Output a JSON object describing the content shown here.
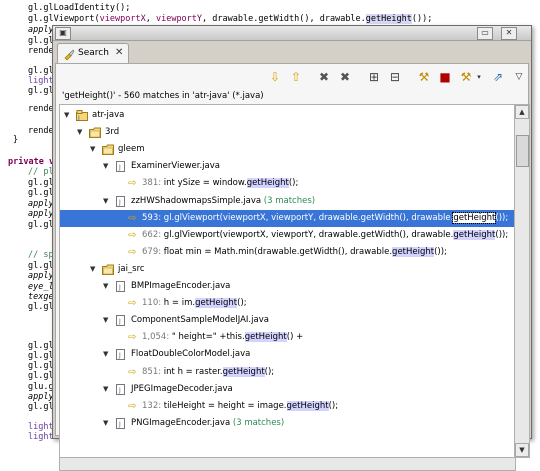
{
  "background_code": [
    "gl.glLoadIdentity();",
    "gl.glViewport(viewportX, viewportY, drawable.getWidth(), drawable.getHeight());",
    "applyR",
    "gl.gl",
    "render",
    "gl.gl",
    "light",
    "gl.gl",
    "render",
    "render",
    "}",
    "private vo",
    "// pl",
    "gl.gl",
    "gl.gl",
    "applyT",
    "applyR",
    "gl.gl",
    "// sp",
    "gl.gl",
    "applyT",
    "eye_li",
    "texgen",
    "gl.gl",
    "gl.gl",
    "gl.gl",
    "gl.gl",
    "gl.gl",
    "glu.gl",
    "applyR",
    "gl.gl",
    "light",
    "light"
  ],
  "window": {
    "tab_label": "Search",
    "summary": "'getHeight()' - 560 matches in 'atr-java' (*.java)",
    "colors": {
      "selection": "#3875d7",
      "highlight": "#d3d3ff",
      "count": "#2e8b57"
    }
  },
  "tree": [
    {
      "kind": "project",
      "label": "atr-java",
      "icon": "project-icon"
    },
    {
      "kind": "folder",
      "label": "3rd",
      "icon": "folder-icon"
    },
    {
      "kind": "folder",
      "label": "gleem",
      "icon": "folder-icon"
    },
    {
      "kind": "file",
      "label": "ExaminerViewer.java",
      "icon": "java-file-icon"
    },
    {
      "kind": "match",
      "num": "381:",
      "pre": "int ySize = window.",
      "hit": "getHeight",
      "post": "();"
    },
    {
      "kind": "file",
      "label": "zzHWShadowmapsSimple.java",
      "count": "(3 matches)",
      "icon": "java-file-icon"
    },
    {
      "kind": "match",
      "num": "593:",
      "pre": "gl.glViewport(viewportX, viewportY, drawable.getWidth(), drawable.",
      "hit": "getHeight",
      "post": "());",
      "selected": true
    },
    {
      "kind": "match",
      "num": "662:",
      "pre": "gl.glViewport(viewportX, viewportY, drawable.getWidth(), drawable.",
      "hit": "getHeight",
      "post": "());"
    },
    {
      "kind": "match",
      "num": "679:",
      "pre": "float min = Math.min(drawable.getWidth(), drawable.",
      "hit": "getHeight",
      "post": "());"
    },
    {
      "kind": "folder",
      "label": "jai_src",
      "icon": "folder-icon"
    },
    {
      "kind": "file",
      "label": "BMPImageEncoder.java",
      "icon": "java-file-icon"
    },
    {
      "kind": "match",
      "num": "110:",
      "pre": "h = im.",
      "hit": "getHeight",
      "post": "();"
    },
    {
      "kind": "file",
      "label": "ComponentSampleModelJAI.java",
      "icon": "java-file-icon"
    },
    {
      "kind": "match",
      "num": "1,054:",
      "pre": "\" height=\" +this.",
      "hit": "getHeight",
      "post": "() +"
    },
    {
      "kind": "file",
      "label": "FloatDoubleColorModel.java",
      "icon": "java-file-icon"
    },
    {
      "kind": "match",
      "num": "851:",
      "pre": "int h = raster.",
      "hit": "getHeight",
      "post": "();"
    },
    {
      "kind": "file",
      "label": "JPEGImageDecoder.java",
      "icon": "java-file-icon"
    },
    {
      "kind": "match",
      "num": "132:",
      "pre": "tileHeight = height = image.",
      "hit": "getHeight",
      "post": "();"
    },
    {
      "kind": "file",
      "label": "PNGImageEncoder.java",
      "count": "(3 matches)",
      "icon": "java-file-icon"
    }
  ]
}
